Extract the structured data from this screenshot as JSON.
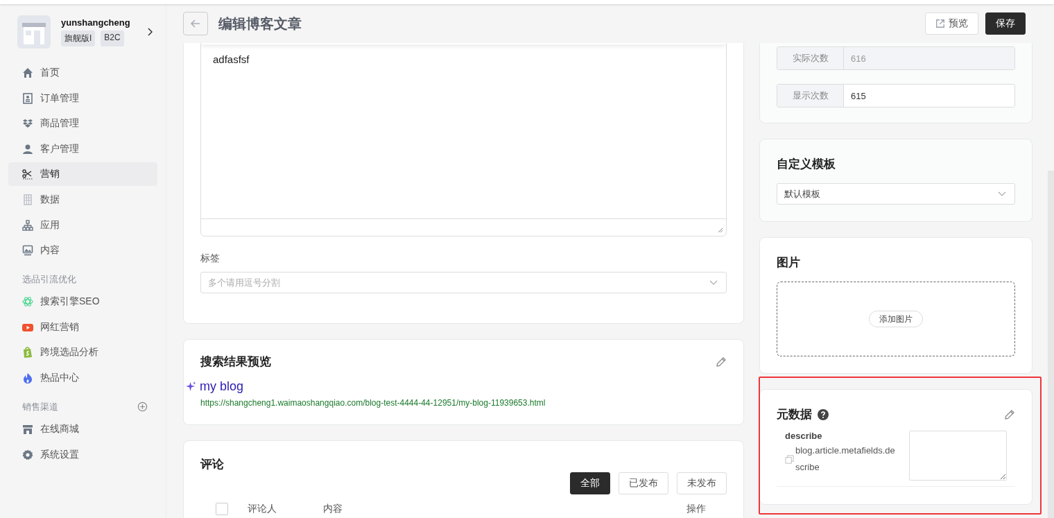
{
  "sidebar": {
    "store": {
      "name": "yunshangcheng",
      "badges": [
        "旗舰版I",
        "B2C"
      ]
    },
    "nav": [
      {
        "label": "首页",
        "selected": false
      },
      {
        "label": "订单管理",
        "selected": false
      },
      {
        "label": "商品管理",
        "selected": false
      },
      {
        "label": "客户管理",
        "selected": false
      },
      {
        "label": "营销",
        "selected": true
      },
      {
        "label": "数据",
        "selected": false
      },
      {
        "label": "应用",
        "selected": false
      },
      {
        "label": "内容",
        "selected": false
      }
    ],
    "sections": [
      {
        "title": "选品引流优化",
        "has_add": false,
        "items": [
          {
            "label": "搜索引擎SEO",
            "selected": false
          },
          {
            "label": "网红营销",
            "selected": false
          },
          {
            "label": "跨境选品分析",
            "selected": false
          },
          {
            "label": "热品中心",
            "selected": false
          }
        ]
      },
      {
        "title": "销售渠道",
        "has_add": true,
        "items": [
          {
            "label": "在线商城",
            "selected": false
          },
          {
            "label": "系统设置",
            "selected": false
          }
        ]
      }
    ]
  },
  "header": {
    "title": "编辑博客文章",
    "buttons": [
      {
        "label": "预览",
        "kind": "outline"
      },
      {
        "label": "保存",
        "kind": "primary"
      }
    ]
  },
  "editor": {
    "content": "adfasfsf",
    "tags": {
      "label": "标签",
      "placeholder": "多个请用逗号分割"
    }
  },
  "seo_preview": {
    "title": "搜索结果预览",
    "page_title": "my blog",
    "url": "https://shangcheng1.waimaoshangqiao.com/blog-test-4444-44-12951/my-blog-11939653.html"
  },
  "comments": {
    "title": "评论",
    "filters": [
      {
        "label": "全部",
        "selected": true
      },
      {
        "label": "已发布",
        "selected": false
      },
      {
        "label": "未发布",
        "selected": false
      }
    ],
    "select_all": {
      "checked": false
    },
    "columns": [
      "评论人",
      "内容",
      "操作"
    ]
  },
  "views": [
    {
      "label": "实际次数",
      "value": "616",
      "disabled": true
    },
    {
      "label": "显示次数",
      "value": "615",
      "disabled": false
    }
  ],
  "template": {
    "title": "自定义模板",
    "value": "默认模板"
  },
  "image": {
    "title": "图片",
    "button": "添加图片"
  },
  "metadata": {
    "title": "元数据",
    "highlighted": true,
    "fields": [
      {
        "name": "describe",
        "key": "blog.article.metafields.describe"
      }
    ]
  }
}
